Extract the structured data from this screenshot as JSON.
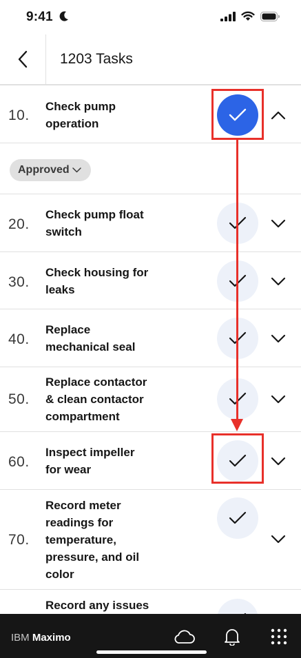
{
  "status_bar": {
    "time": "9:41"
  },
  "header": {
    "title": "1203 Tasks"
  },
  "tasks": [
    {
      "number": "10.",
      "lines": [
        "Check pump",
        "operation"
      ],
      "completed": true,
      "expanded": true
    },
    {
      "number": "20.",
      "lines": [
        "Check pump float",
        "switch"
      ],
      "completed": false,
      "expanded": false
    },
    {
      "number": "30.",
      "lines": [
        "Check housing for",
        "leaks"
      ],
      "completed": false,
      "expanded": false
    },
    {
      "number": "40.",
      "lines": [
        "Replace",
        "mechanical seal"
      ],
      "completed": false,
      "expanded": false
    },
    {
      "number": "50.",
      "lines": [
        "Replace contactor",
        "& clean contactor",
        "compartment"
      ],
      "completed": false,
      "expanded": false
    },
    {
      "number": "60.",
      "lines": [
        "Inspect impeller",
        "for wear"
      ],
      "completed": false,
      "expanded": false
    },
    {
      "number": "70.",
      "lines": [
        "Record meter",
        "readings for",
        "temperature,",
        "pressure, and oil",
        "color"
      ],
      "completed": false,
      "expanded": false
    },
    {
      "number": "80.",
      "lines": [
        "Record any issues"
      ],
      "completed": false,
      "expanded": false
    }
  ],
  "expanded_task": {
    "status": "Approved"
  },
  "bottom_bar": {
    "brand_ibm": "IBM",
    "brand_product": "Maximo"
  },
  "colors": {
    "accent": "#2c64e6",
    "check_bg": "#edf1f9",
    "annotation": "#e8302a",
    "bottom_bar": "#161616"
  }
}
